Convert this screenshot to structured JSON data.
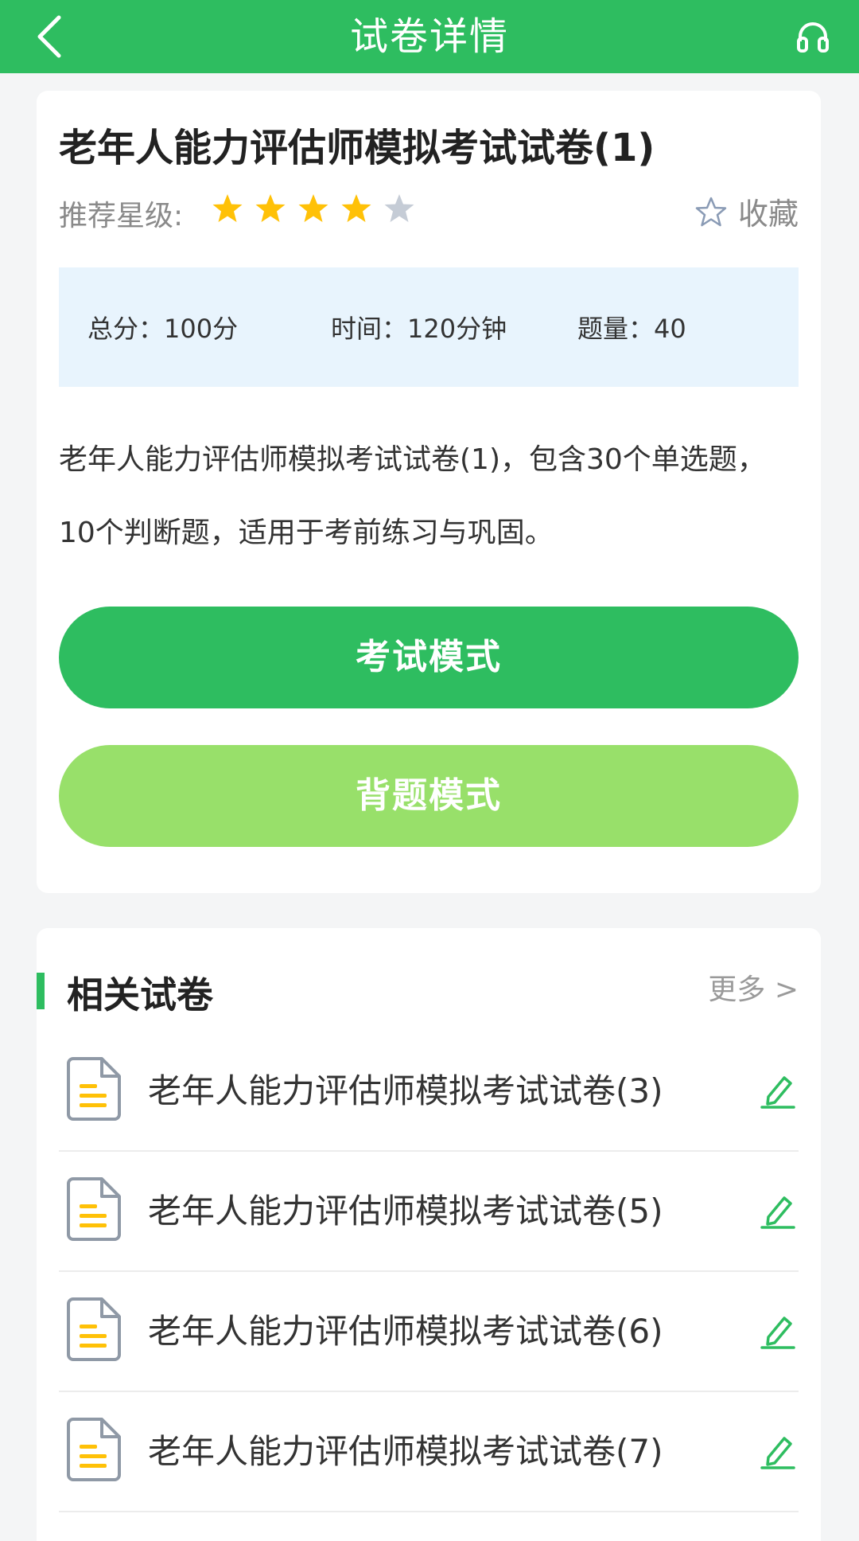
{
  "header": {
    "title": "试卷详情",
    "back_icon": "chevron-left-icon",
    "service_icon": "headset-icon",
    "color": "#2ebd60"
  },
  "paper": {
    "title": "老年人能力评估师模拟考试试卷(1)",
    "rating_label": "推荐星级:",
    "rating": 4,
    "rating_max": 5,
    "favorite_label": "收藏",
    "total_score": "总分：100分",
    "time": "时间：120分钟",
    "question_count": "题量：40",
    "description": "老年人能力评估师模拟考试试卷(1)，包含30个单选题，10个判断题，适用于考前练习与巩固。",
    "exam_mode_label": "考试模式",
    "memorize_mode_label": "背题模式"
  },
  "related": {
    "title": "相关试卷",
    "more_label": "更多 >",
    "items": [
      {
        "label": "老年人能力评估师模拟考试试卷(3)"
      },
      {
        "label": "老年人能力评估师模拟考试试卷(5)"
      },
      {
        "label": "老年人能力评估师模拟考试试卷(6)"
      },
      {
        "label": "老年人能力评估师模拟考试试卷(7)"
      }
    ]
  },
  "colors": {
    "primary": "#2ebd60",
    "secondary_button": "#98e06a",
    "star_active": "#ffc107",
    "star_inactive": "#c5ccd6",
    "info_bg": "#e8f4fd"
  }
}
